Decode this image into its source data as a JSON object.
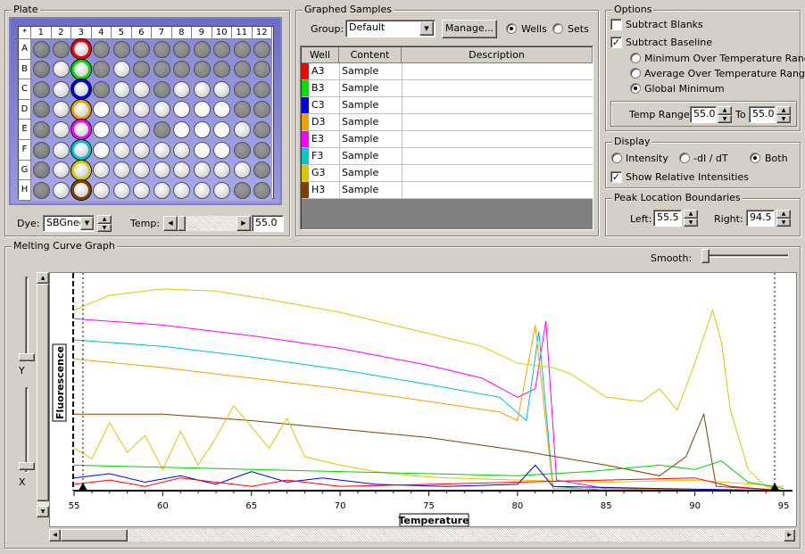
{
  "plate": {
    "title": "Plate",
    "corner": "*",
    "columns": [
      "1",
      "2",
      "3",
      "4",
      "5",
      "6",
      "7",
      "8",
      "9",
      "10",
      "11",
      "12"
    ],
    "rows": [
      "A",
      "B",
      "C",
      "D",
      "E",
      "F",
      "G",
      "H"
    ],
    "dye_label": "Dye:",
    "dye_value": "SBGnee",
    "temp_label": "Temp:",
    "temp_value": "55.0"
  },
  "graphed": {
    "title": "Graphed Samples",
    "group_label": "Group:",
    "group_value": "Default",
    "manage_label": "Manage...",
    "wells_label": "Wells",
    "sets_label": "Sets",
    "columns": [
      "Well",
      "Content",
      "Description"
    ],
    "rows": [
      {
        "well": "A3",
        "content": "Sample",
        "description": "",
        "color": "#ff0000"
      },
      {
        "well": "B3",
        "content": "Sample",
        "description": "",
        "color": "#00e000"
      },
      {
        "well": "C3",
        "content": "Sample",
        "description": "",
        "color": "#0000e0"
      },
      {
        "well": "D3",
        "content": "Sample",
        "description": "",
        "color": "#f0a000"
      },
      {
        "well": "E3",
        "content": "Sample",
        "description": "",
        "color": "#ff00ff"
      },
      {
        "well": "F3",
        "content": "Sample",
        "description": "",
        "color": "#00c8c8"
      },
      {
        "well": "G3",
        "content": "Sample",
        "description": "",
        "color": "#d8c800"
      },
      {
        "well": "H3",
        "content": "Sample",
        "description": "",
        "color": "#804000"
      }
    ]
  },
  "options": {
    "title": "Options",
    "subtract_blanks": "Subtract Blanks",
    "subtract_baseline": "Subtract Baseline",
    "min_over": "Minimum Over Temperature Range",
    "avg_over": "Average Over Temperature Range",
    "global_min": "Global Minimum",
    "temp_range_label": "Temp Range:",
    "temp_from": "55.0",
    "to_label": "To",
    "temp_to": "55.0"
  },
  "display": {
    "title": "Display",
    "intensity": "Intensity",
    "dl_dt": "-dI / dT",
    "both": "Both",
    "show_relative": "Show Relative Intensities"
  },
  "peak": {
    "title": "Peak Location Boundaries",
    "left_label": "Left:",
    "left_value": "55.5",
    "right_label": "Right:",
    "right_value": "94.5"
  },
  "graph": {
    "title": "Melting Curve Graph",
    "smooth_label": "Smooth:",
    "y_label": "Y",
    "x_label": "X"
  },
  "chart_data": {
    "type": "line",
    "xlabel": "Temperature",
    "ylabel": "Fluorescence",
    "xlim": [
      55,
      95
    ],
    "x_ticks": [
      "55",
      "60",
      "65",
      "70",
      "75",
      "80",
      "85",
      "90",
      "95"
    ],
    "ylim": [
      0,
      100
    ],
    "series": [
      {
        "color": "#ff00ff",
        "points": [
          [
            55,
            81
          ],
          [
            60,
            78
          ],
          [
            65,
            73
          ],
          [
            70,
            67
          ],
          [
            75,
            59
          ],
          [
            78,
            53
          ],
          [
            80,
            44
          ],
          [
            81,
            48
          ],
          [
            81.6,
            80
          ],
          [
            82.2,
            5
          ],
          [
            85,
            1
          ],
          [
            95,
            0
          ]
        ]
      },
      {
        "color": "#00c0c0",
        "points": [
          [
            55,
            71
          ],
          [
            60,
            68
          ],
          [
            65,
            63
          ],
          [
            70,
            57
          ],
          [
            75,
            50
          ],
          [
            79,
            44
          ],
          [
            80.5,
            33
          ],
          [
            81.2,
            75
          ],
          [
            82,
            2
          ],
          [
            85,
            0
          ],
          [
            95,
            0
          ]
        ]
      },
      {
        "color": "#f0a000",
        "points": [
          [
            55,
            62
          ],
          [
            60,
            58
          ],
          [
            65,
            53
          ],
          [
            70,
            48
          ],
          [
            75,
            42
          ],
          [
            79,
            37
          ],
          [
            80,
            33
          ],
          [
            81,
            78
          ],
          [
            82,
            1
          ],
          [
            95,
            0
          ]
        ]
      },
      {
        "color": "#804000",
        "points": [
          [
            55,
            36
          ],
          [
            60,
            36
          ],
          [
            65,
            33
          ],
          [
            70,
            29
          ],
          [
            75,
            25
          ],
          [
            80,
            19
          ],
          [
            85,
            12
          ],
          [
            88,
            7
          ],
          [
            89.5,
            16
          ],
          [
            90.5,
            36
          ],
          [
            91.2,
            2
          ],
          [
            95,
            0
          ]
        ]
      },
      {
        "color": "#d8c800",
        "points": [
          [
            55,
            85
          ],
          [
            57,
            92
          ],
          [
            60,
            95
          ],
          [
            63,
            94
          ],
          [
            66,
            90
          ],
          [
            70,
            84
          ],
          [
            74,
            76
          ],
          [
            78,
            68
          ],
          [
            80,
            60
          ],
          [
            82,
            58
          ],
          [
            83,
            55
          ],
          [
            85,
            44
          ],
          [
            87,
            42
          ],
          [
            88,
            48
          ],
          [
            89,
            38
          ],
          [
            90,
            60
          ],
          [
            91,
            85
          ],
          [
            91.5,
            70
          ],
          [
            92,
            38
          ],
          [
            93,
            10
          ],
          [
            94,
            2
          ],
          [
            95,
            0
          ]
        ]
      },
      {
        "color": "#d8c800",
        "points": [
          [
            55,
            20
          ],
          [
            56,
            15
          ],
          [
            57,
            32
          ],
          [
            58,
            18
          ],
          [
            59,
            26
          ],
          [
            60,
            10
          ],
          [
            61,
            28
          ],
          [
            62,
            12
          ],
          [
            63,
            25
          ],
          [
            64,
            40
          ],
          [
            65,
            30
          ],
          [
            66,
            20
          ],
          [
            67,
            34
          ],
          [
            68,
            16
          ],
          [
            70,
            12
          ],
          [
            72,
            9
          ],
          [
            74,
            7
          ],
          [
            76,
            6
          ],
          [
            80,
            5
          ],
          [
            85,
            4
          ],
          [
            90,
            5
          ],
          [
            95,
            2
          ]
        ]
      },
      {
        "color": "#00d000",
        "points": [
          [
            55,
            12
          ],
          [
            60,
            11
          ],
          [
            65,
            10
          ],
          [
            70,
            9
          ],
          [
            75,
            8
          ],
          [
            80,
            7
          ],
          [
            84,
            9
          ],
          [
            88,
            12
          ],
          [
            90,
            10
          ],
          [
            91.5,
            14
          ],
          [
            93,
            4
          ],
          [
            95,
            1
          ]
        ]
      },
      {
        "color": "#0000e0",
        "points": [
          [
            55,
            6
          ],
          [
            57,
            8
          ],
          [
            59,
            4
          ],
          [
            61,
            7
          ],
          [
            63,
            3
          ],
          [
            65,
            9
          ],
          [
            67,
            4
          ],
          [
            69,
            6
          ],
          [
            72,
            3
          ],
          [
            76,
            2
          ],
          [
            80,
            3
          ],
          [
            81,
            12
          ],
          [
            82,
            2
          ],
          [
            88,
            1
          ],
          [
            95,
            0
          ]
        ]
      },
      {
        "color": "#ff0000",
        "points": [
          [
            55,
            3
          ],
          [
            57,
            5
          ],
          [
            59,
            2
          ],
          [
            61,
            6
          ],
          [
            63,
            4
          ],
          [
            65,
            2
          ],
          [
            67,
            5
          ],
          [
            70,
            2
          ],
          [
            75,
            3
          ],
          [
            80,
            4
          ],
          [
            85,
            5
          ],
          [
            90,
            6
          ],
          [
            92,
            2
          ],
          [
            95,
            0
          ]
        ]
      }
    ]
  }
}
